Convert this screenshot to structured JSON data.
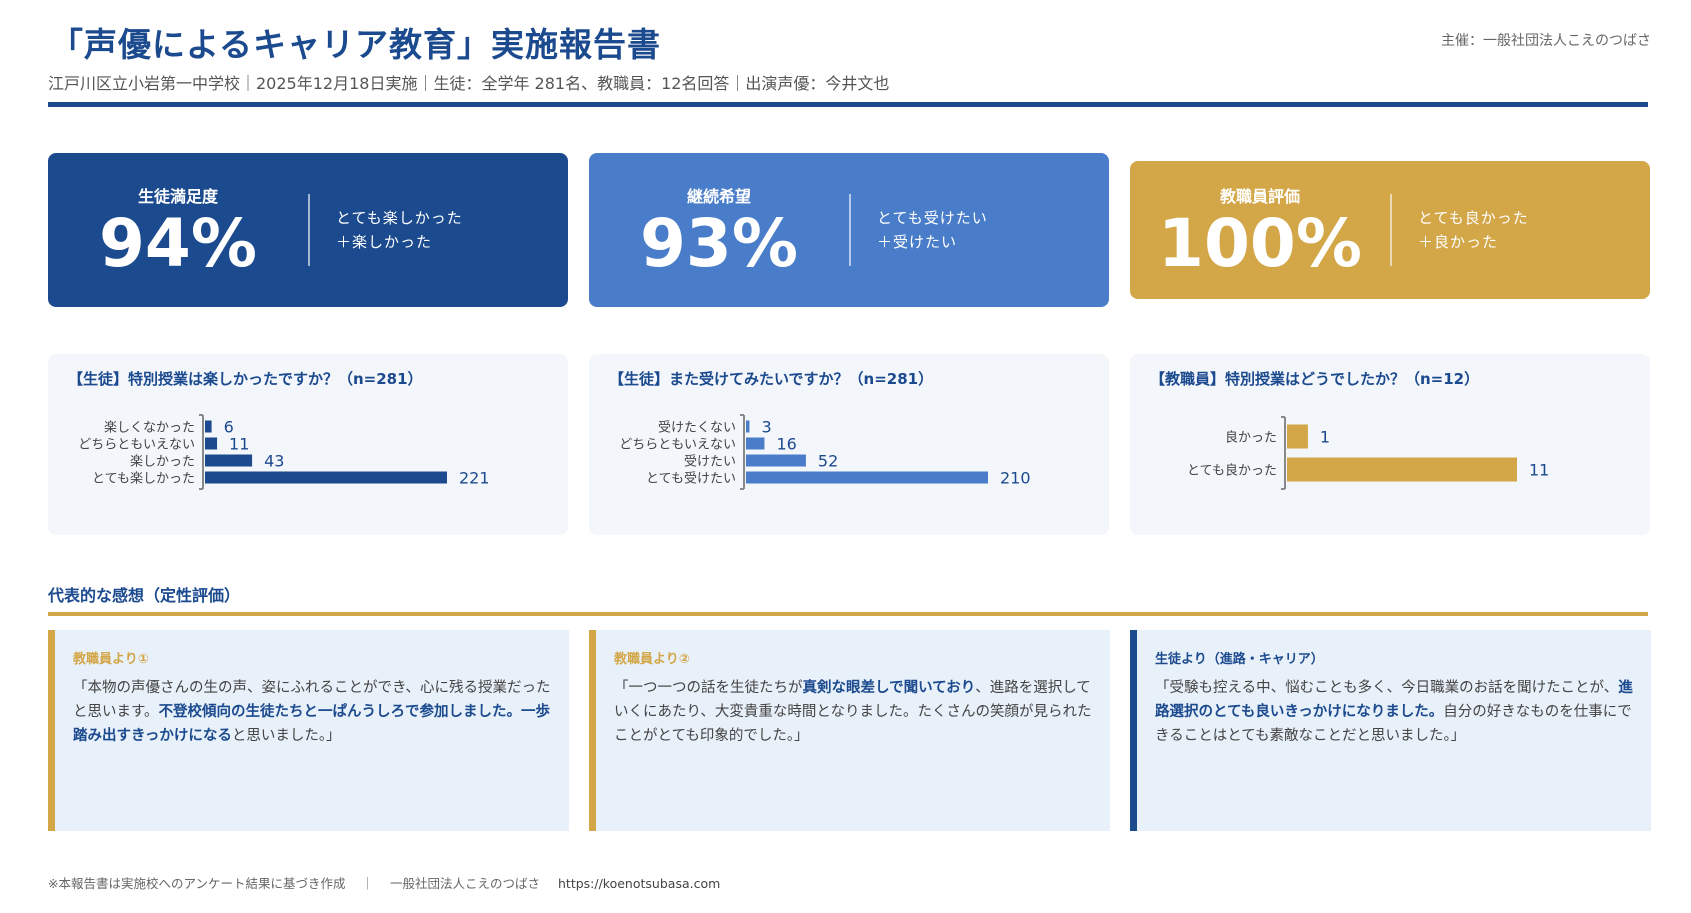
{
  "header": {
    "title": "「声優によるキャリア教育」実施報告書",
    "host": "主催：一般社団法人こえのつばさ",
    "subtitle": "江戸川区立小岩第一中学校｜2025年12月18日実施｜生徒：全学年 281名、教職員：12名回答｜出演声優：今井文也"
  },
  "kpis": [
    {
      "label": "生徒満足度",
      "value": "94%",
      "note1": "とても楽しかった",
      "note2": "＋楽しかった"
    },
    {
      "label": "継続希望",
      "value": "93%",
      "note1": "とても受けたい",
      "note2": "＋受けたい"
    },
    {
      "label": "教職員評価",
      "value": "100%",
      "note1": "とても良かった",
      "note2": "＋良かった"
    }
  ],
  "colors": {
    "navy": "#1b4a8e",
    "blue": "#4a7dc9",
    "gold": "#d3a647"
  },
  "chart_data": [
    {
      "type": "bar",
      "orientation": "horizontal",
      "title": "【生徒】特別授業は楽しかったですか？（n=281）",
      "categories": [
        "楽しくなかった",
        "どちらともいえない",
        "楽しかった",
        "とても楽しかった"
      ],
      "values": [
        6,
        11,
        43,
        221
      ],
      "color": "#1b4a8e",
      "xlim": [
        0,
        221
      ]
    },
    {
      "type": "bar",
      "orientation": "horizontal",
      "title": "【生徒】また受けてみたいですか？（n=281）",
      "categories": [
        "受けたくない",
        "どちらともいえない",
        "受けたい",
        "とても受けたい"
      ],
      "values": [
        3,
        16,
        52,
        210
      ],
      "color": "#4a7dc9",
      "xlim": [
        0,
        210
      ]
    },
    {
      "type": "bar",
      "orientation": "horizontal",
      "title": "【教職員】特別授業はどうでしたか？（n=12）",
      "categories": [
        "良かった",
        "とても良かった"
      ],
      "values": [
        1,
        11
      ],
      "color": "#d3a647",
      "xlim": [
        0,
        11
      ]
    }
  ],
  "section": {
    "title": "代表的な感想（定性評価）"
  },
  "quotes": [
    {
      "head": "教職員より①",
      "parts": [
        {
          "t": "「本物の声優さんの生の声、姿にふれることができ、心に残る授業だったと思います。"
        },
        {
          "t": "不登校傾向の生徒たちと一ぱんうしろで参加しました。一歩踏み出すきっかけになる",
          "b": true
        },
        {
          "t": "と思いました。」"
        }
      ]
    },
    {
      "head": "教職員より②",
      "parts": [
        {
          "t": "「一つ一つの話を生徒たちが"
        },
        {
          "t": "真剣な眼差しで聞いており",
          "b": true
        },
        {
          "t": "、進路を選択していくにあたり、大変貴重な時間となりました。たくさんの笑顔が見られたことがとても印象的でした。」"
        }
      ]
    },
    {
      "head": "生徒より（進路・キャリア）",
      "parts": [
        {
          "t": "「受験も控える中、悩むことも多く、今日職業のお話を聞けたことが、"
        },
        {
          "t": "進路選択のとても良いきっかけになりました。",
          "b": true
        },
        {
          "t": "自分の好きなものを仕事にできることはとても素敵なことだと思いました。」"
        }
      ]
    }
  ],
  "footer": {
    "note": "※本報告書は実施校へのアンケート結果に基づき作成",
    "sep": "｜",
    "org": "一般社団法人こえのつばさ",
    "url": "https://koenotsubasa.com"
  }
}
